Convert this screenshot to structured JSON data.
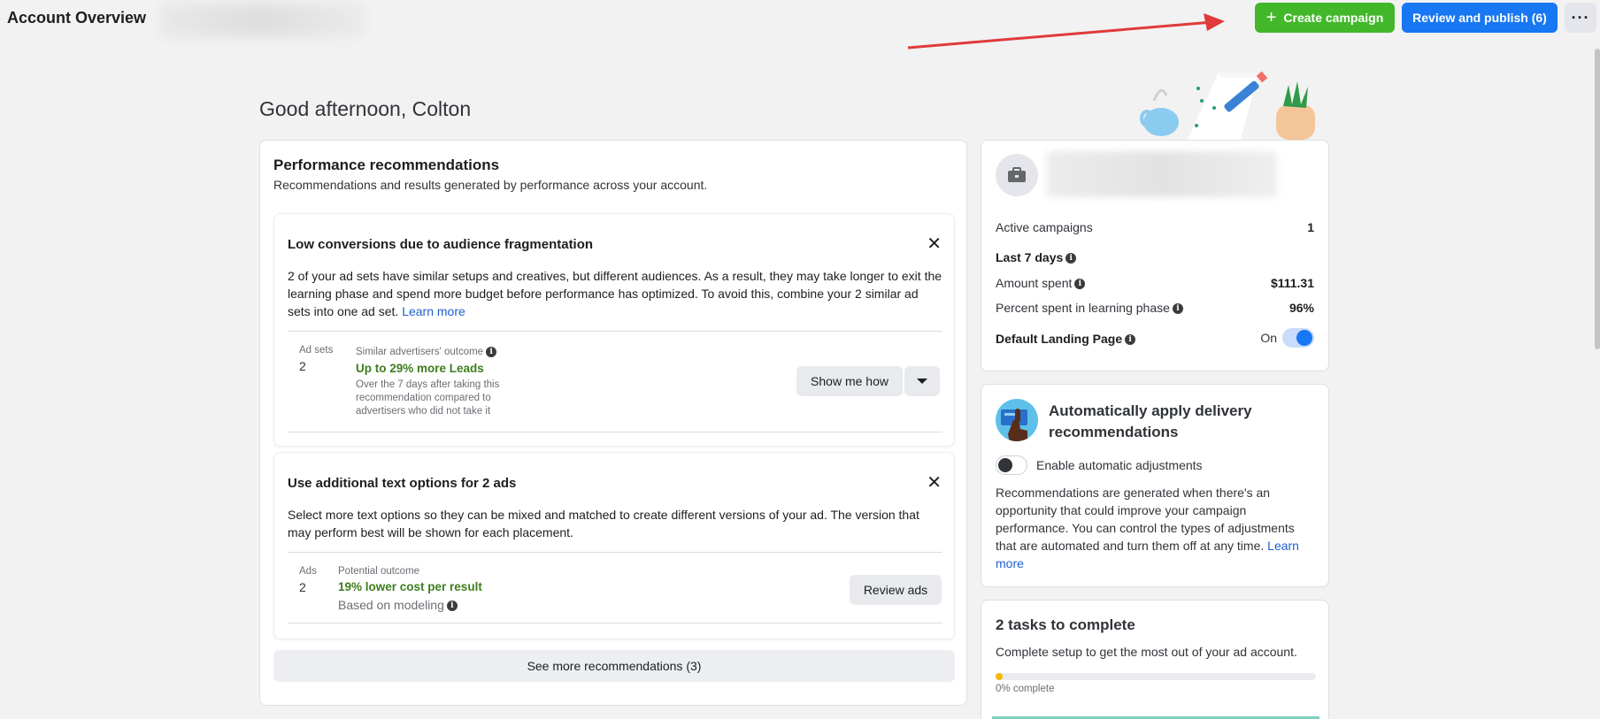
{
  "header": {
    "title": "Account Overview",
    "create_label": "Create campaign",
    "review_label": "Review and publish (6)",
    "more_label": "···"
  },
  "greeting": "Good afternoon, Colton",
  "performance": {
    "title": "Performance recommendations",
    "subtitle": "Recommendations and results generated by performance across your account.",
    "recommendations": [
      {
        "title": "Low conversions due to audience fragmentation",
        "body": "2 of your ad sets have similar setups and creatives, but different audiences. As a result, they may take longer to exit the learning phase and spend more budget before performance has optimized. To avoid this, combine your 2 similar ad sets into one ad set.",
        "link": "Learn more",
        "metric_label": "Ad sets",
        "metric_value": "2",
        "outcome_label": "Similar advertisers' outcome",
        "outcome_value": "Up to 29% more Leads",
        "outcome_note": "Over the 7 days after taking this recommendation compared to advertisers who did not take it",
        "action_label": "Show me how"
      },
      {
        "title": "Use additional text options for 2 ads",
        "body": "Select more text options so they can be mixed and matched to create different versions of your ad. The version that may perform best will be shown for each placement.",
        "metric_label": "Ads",
        "metric_value": "2",
        "outcome_label": "Potential outcome",
        "outcome_value": "19% lower cost per result",
        "outcome_note": "Based on modeling",
        "action_label": "Review ads"
      }
    ],
    "see_more_label": "See more recommendations (3)"
  },
  "account": {
    "active_campaigns_label": "Active campaigns",
    "active_campaigns_value": "1",
    "period_label": "Last 7 days",
    "amount_spent_label": "Amount spent",
    "amount_spent_value": "$111.31",
    "learning_label": "Percent spent in learning phase",
    "learning_value": "96%",
    "landing_label": "Default Landing Page",
    "landing_state": "On"
  },
  "delivery": {
    "title": "Automatically apply delivery recommendations",
    "toggle_label": "Enable automatic adjustments",
    "body": "Recommendations are generated when there's an opportunity that could improve your campaign performance. You can control the types of adjustments that are automated and turn them off at any time.",
    "link": "Learn more"
  },
  "tasks": {
    "title": "2 tasks to complete",
    "subtitle": "Complete setup to get the most out of your ad account.",
    "progress_label": "0% complete",
    "progress_fraction": 0
  },
  "colors": {
    "create": "#42b72a",
    "review": "#1877f2",
    "outcome_green": "#3e7d1e",
    "arrow": "#e03a3a"
  }
}
